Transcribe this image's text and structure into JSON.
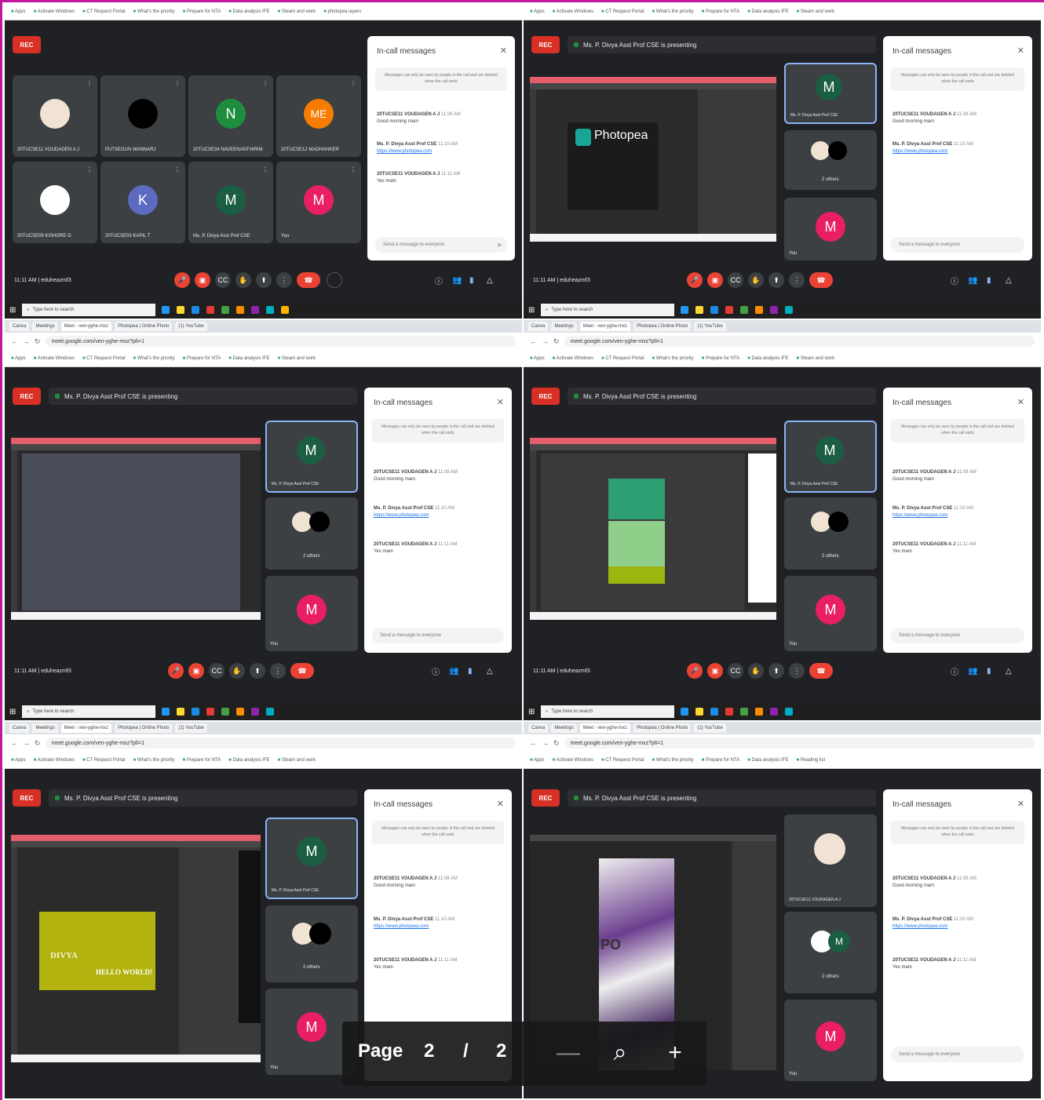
{
  "meet": {
    "rec_label": "REC",
    "chat_title": "In-call messages",
    "chat_note": "Messages can only be seen by people in the call and are deleted when the call ends",
    "send_placeholder": "Send a message to everyone",
    "close_glyph": "✕",
    "presenting": "Ms. P. Divya Asst Prof CSE is presenting",
    "clock": "11:11 AM  |  eduheazmf3",
    "search_placeholder": "Type here to search"
  },
  "chrome": {
    "tabs": [
      "Canva",
      "Meetings",
      "Meet - ven-yghe-mxz",
      "Photopea | Online Photo",
      "(1) YouTube"
    ],
    "address": "meet.google.com/ven-yghe-mxz?pli=1",
    "bookmarks": [
      "Apps",
      "Activate Windows",
      "CT Request Portal",
      "What's the priority",
      "Prepare for NTA",
      "Data analysis IFE",
      "Steam and work",
      "photopea layers",
      "Reading list"
    ]
  },
  "panel1": {
    "participants": [
      {
        "name": "20TUCSE11 VOUDAGEN A J",
        "initial": "",
        "color": "#f1e3d3"
      },
      {
        "name": "PUTSEGUN WANNARJ",
        "initial": "",
        "color": "#000000"
      },
      {
        "name": "20TUCSE34 NAVEENANTHIRIM",
        "initial": "N",
        "color": "#1e8e3e"
      },
      {
        "name": "20TUCSE12 MADHANKER",
        "initial": "ME",
        "color": "#f57c00"
      },
      {
        "name": "20TUCSE09 KISHORE G",
        "initial": "",
        "color": "#ffffff"
      },
      {
        "name": "20TUCSE03 KAPIL T",
        "initial": "K",
        "color": "#5c6bc0"
      },
      {
        "name": "Ms. P. Divya Asst Prof CSE",
        "initial": "M",
        "color": "#1b5e43"
      },
      {
        "name": "You",
        "initial": "M",
        "color": "#e91e63"
      }
    ]
  },
  "chat_messages": [
    {
      "sender": "20TUCSE11 VOUDAGEN A J",
      "time": "11:08 AM",
      "text": "Good morning mam",
      "link": ""
    },
    {
      "sender": "Ms. P. Divya Asst Prof CSE",
      "time": "11:10 AM",
      "text": "",
      "link": "https://www.photopea.com"
    },
    {
      "sender": "20TUCSE11 VOUDAGEN A J",
      "time": "11:11 AM",
      "text": "Yes mam",
      "link": ""
    }
  ],
  "side_tiles": {
    "main": "Ms. P. Divya Asst Prof CSE",
    "others": "2 others",
    "you": "You",
    "student": "20TUCSE11 VOUDAGEN A J"
  },
  "photopea": {
    "title": "Photopea"
  },
  "canvas_text": {
    "divya": "DIVYA",
    "hello": "HELLO WORLD!",
    "po": "PO"
  },
  "pager": {
    "label": "Page",
    "current": "2",
    "separator": "/",
    "total": "2",
    "zoom_out": "—",
    "zoom_icon": "⌕",
    "zoom_in": "+"
  }
}
